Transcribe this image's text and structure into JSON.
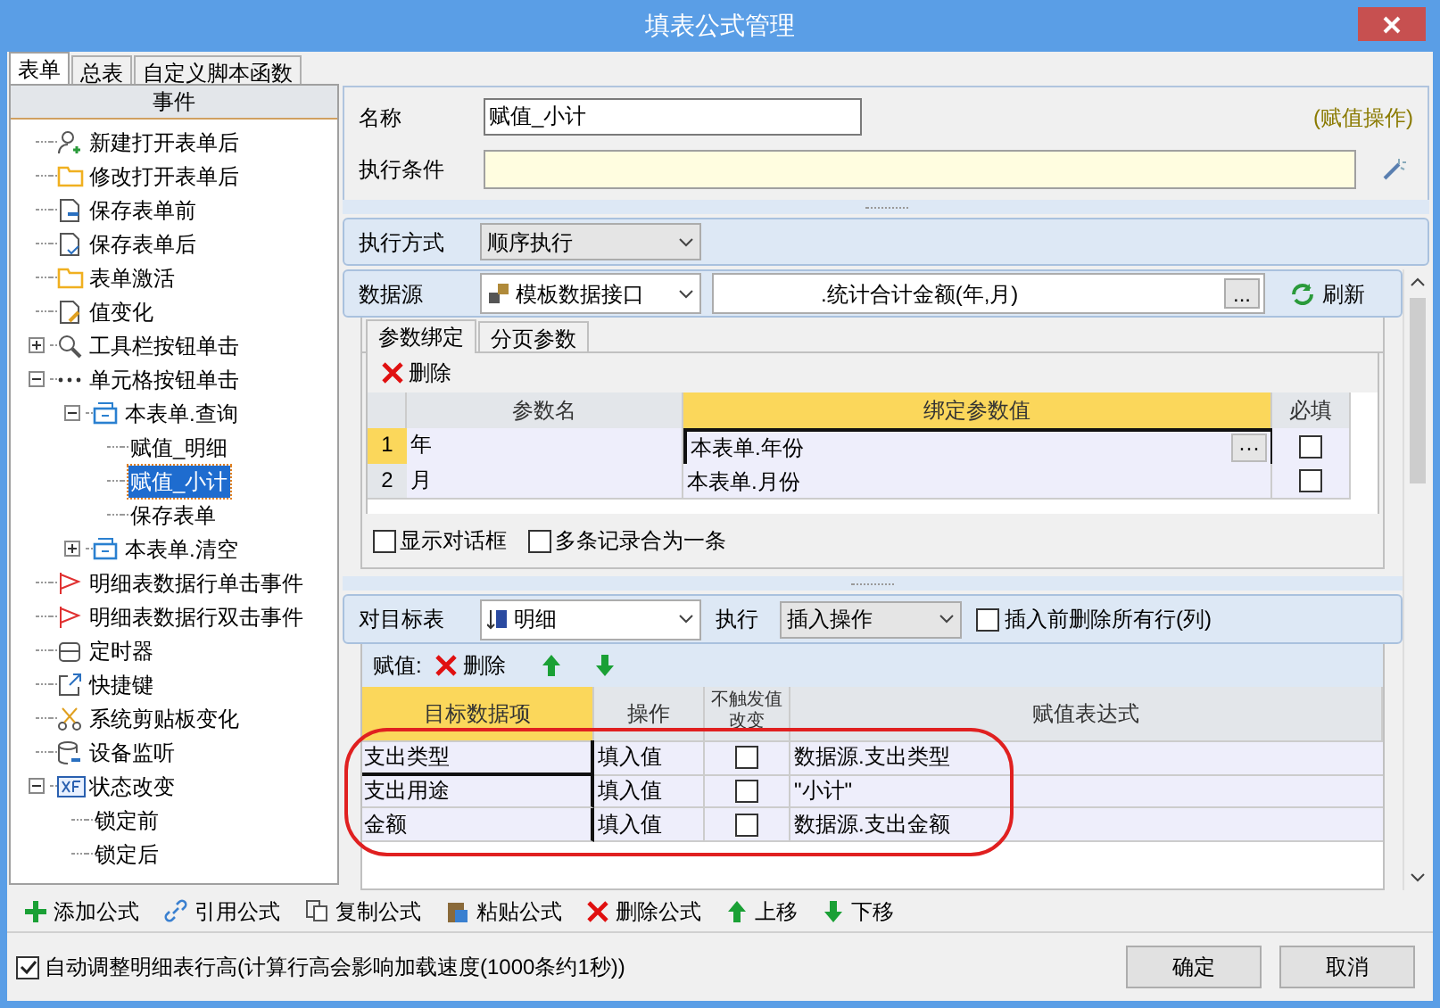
{
  "window": {
    "title": "填表公式管理"
  },
  "left_tabs": [
    {
      "label": "表单",
      "selected": true
    },
    {
      "label": "总表",
      "selected": false
    },
    {
      "label": "自定义脚本函数",
      "selected": false
    }
  ],
  "tree": {
    "header": "事件",
    "items": [
      {
        "label": "新建打开表单后",
        "selected": false
      },
      {
        "label": "修改打开表单后",
        "selected": false
      },
      {
        "label": "保存表单前",
        "selected": false
      },
      {
        "label": "保存表单后",
        "selected": false
      },
      {
        "label": "表单激活",
        "selected": false
      },
      {
        "label": "值变化",
        "selected": false
      },
      {
        "label": "工具栏按钮单击",
        "selected": false,
        "expanded": false
      },
      {
        "label": "单元格按钮单击",
        "selected": false,
        "expanded": true,
        "children": [
          {
            "label": "本表单.查询",
            "selected": false,
            "expanded": true,
            "children": [
              {
                "label": "赋值_明细",
                "selected": false
              },
              {
                "label": "赋值_小计",
                "selected": true
              },
              {
                "label": "保存表单",
                "selected": false
              }
            ]
          },
          {
            "label": "本表单.清空",
            "selected": false,
            "expanded": false
          }
        ]
      },
      {
        "label": "明细表数据行单击事件",
        "selected": false
      },
      {
        "label": "明细表数据行双击事件",
        "selected": false
      },
      {
        "label": "定时器",
        "selected": false
      },
      {
        "label": "快捷键",
        "selected": false
      },
      {
        "label": "系统剪贴板变化",
        "selected": false
      },
      {
        "label": "设备监听",
        "selected": false
      },
      {
        "label": "状态改变",
        "selected": false,
        "expanded": true,
        "children": [
          {
            "label": "锁定前",
            "selected": false
          },
          {
            "label": "锁定后",
            "selected": false
          }
        ]
      }
    ]
  },
  "form": {
    "name_label": "名称",
    "name_value": "赋值_小计",
    "type_note": "(赋值操作)",
    "condition_label": "执行条件"
  },
  "exec_mode": {
    "label": "执行方式",
    "value": "顺序执行"
  },
  "datasource": {
    "label": "数据源",
    "type": "模板数据接口",
    "value": ".统计合计金额(年,月)",
    "browse": "...",
    "refresh": "刷新"
  },
  "param_tabs": [
    {
      "label": "参数绑定",
      "selected": true
    },
    {
      "label": "分页参数",
      "selected": false
    }
  ],
  "param_toolbar": {
    "delete": "删除"
  },
  "param_table": {
    "columns": [
      "参数名",
      "绑定参数值",
      "必填"
    ],
    "rows": [
      {
        "index": "1",
        "name": "年",
        "value": "本表单.年份",
        "button": "···",
        "required": false,
        "selected": true
      },
      {
        "index": "2",
        "name": "月",
        "value": "本表单.月份",
        "required": false,
        "selected": false
      }
    ]
  },
  "options": [
    {
      "label": "显示对话框",
      "checked": false
    },
    {
      "label": "多条记录合为一条",
      "checked": false
    }
  ],
  "target": {
    "label": "对目标表",
    "value": "明细",
    "exec_label": "执行",
    "exec_value": "插入操作",
    "clear_option": {
      "label": "插入前删除所有行(列)",
      "checked": false
    }
  },
  "assign_toolbar": {
    "label": "赋值:",
    "delete": "删除"
  },
  "assign_table": {
    "columns": [
      "目标数据项",
      "操作",
      "不触发值改变",
      "赋值表达式"
    ],
    "rows": [
      {
        "target": "支出类型",
        "op": "填入值",
        "no_trigger": false,
        "expr": "数据源.支出类型",
        "selected": true
      },
      {
        "target": "支出用途",
        "op": "填入值",
        "no_trigger": false,
        "expr": "\"小计\"",
        "selected": false
      },
      {
        "target": "金额",
        "op": "填入值",
        "no_trigger": false,
        "expr": "数据源.支出金额",
        "selected": false
      }
    ]
  },
  "actions": [
    "添加公式",
    "引用公式",
    "复制公式",
    "粘贴公式",
    "删除公式",
    "上移",
    "下移"
  ],
  "auto_height": {
    "label": "自动调整明细表行高(计算行高会影响加载速度(1000条约1秒))",
    "checked": true
  },
  "buttons": [
    "确定",
    "取消"
  ]
}
